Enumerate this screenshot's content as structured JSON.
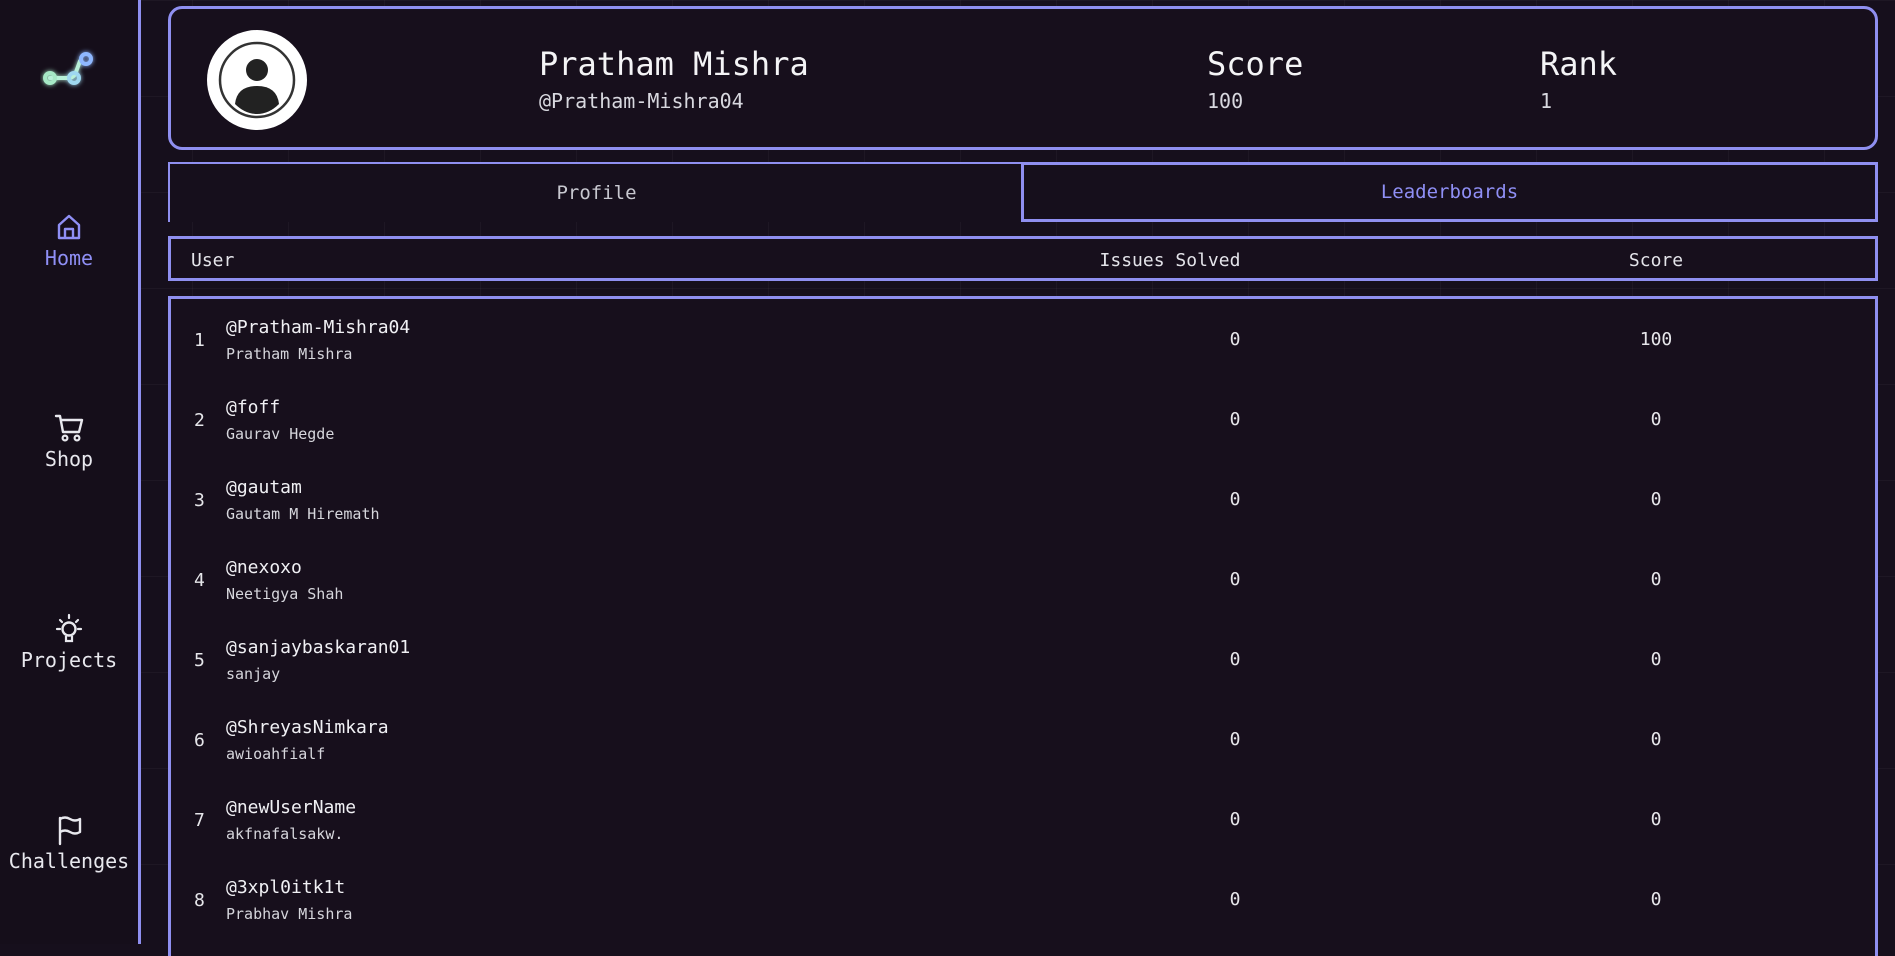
{
  "sidebar": {
    "logo_icon": "graph-nodes-icon",
    "items": [
      {
        "label": "Home",
        "icon": "home-icon",
        "active": true
      },
      {
        "label": "Shop",
        "icon": "cart-icon",
        "active": false
      },
      {
        "label": "Projects",
        "icon": "lightbulb-icon",
        "active": false
      },
      {
        "label": "Challenges",
        "icon": "flag-icon",
        "active": false
      }
    ]
  },
  "profile": {
    "name": "Pratham Mishra",
    "handle": "@Pratham-Mishra04",
    "score_label": "Score",
    "score_value": "100",
    "rank_label": "Rank",
    "rank_value": "1"
  },
  "tabs": [
    {
      "label": "Profile",
      "active": false
    },
    {
      "label": "Leaderboards",
      "active": true
    }
  ],
  "leaderboard": {
    "columns": [
      "User",
      "Issues Solved",
      "Score"
    ],
    "rows": [
      {
        "rank": "1",
        "handle": "@Pratham-Mishra04",
        "name": "Pratham Mishra",
        "issues": "0",
        "score": "100"
      },
      {
        "rank": "2",
        "handle": "@foff",
        "name": "Gaurav Hegde",
        "issues": "0",
        "score": "0"
      },
      {
        "rank": "3",
        "handle": "@gautam",
        "name": "Gautam M Hiremath",
        "issues": "0",
        "score": "0"
      },
      {
        "rank": "4",
        "handle": "@nexoxo",
        "name": "Neetigya Shah",
        "issues": "0",
        "score": "0"
      },
      {
        "rank": "5",
        "handle": "@sanjaybaskaran01",
        "name": "sanjay",
        "issues": "0",
        "score": "0"
      },
      {
        "rank": "6",
        "handle": "@ShreyasNimkara",
        "name": "awioahfialf",
        "issues": "0",
        "score": "0"
      },
      {
        "rank": "7",
        "handle": "@newUserName",
        "name": "akfnafalsakw.",
        "issues": "0",
        "score": "0"
      },
      {
        "rank": "8",
        "handle": "@3xpl0itk1t",
        "name": "Prabhav Mishra",
        "issues": "0",
        "score": "0"
      }
    ]
  },
  "colors": {
    "background": "#160f1c",
    "accent": "#8f8ff0",
    "text": "#e6e6ea"
  }
}
